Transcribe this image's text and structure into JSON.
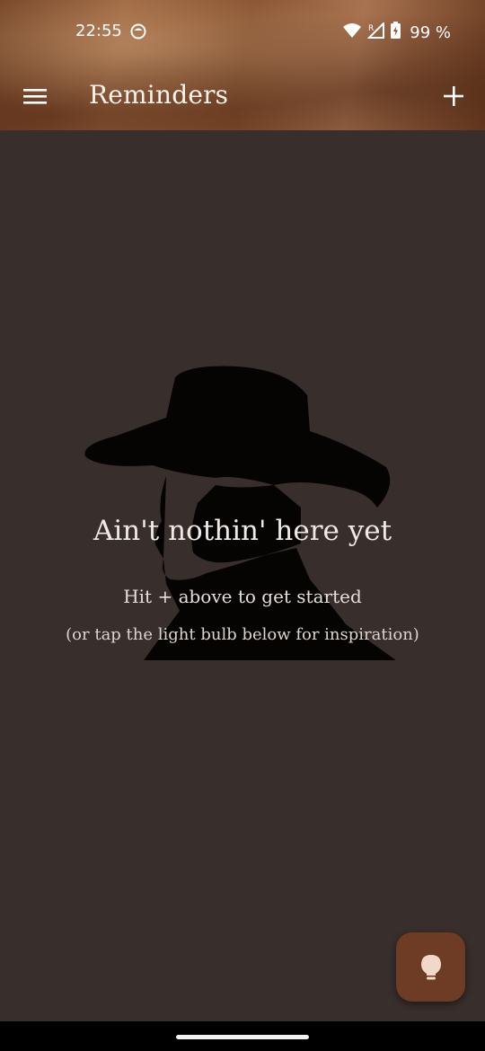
{
  "status_bar": {
    "time": "22:55",
    "battery": "99 %",
    "icons": [
      "app-notification-icon",
      "wifi-icon",
      "cellular-roaming-icon",
      "battery-charging-icon"
    ]
  },
  "app_bar": {
    "title": "Reminders",
    "menu_icon": "hamburger-menu-icon",
    "add_icon": "plus-icon"
  },
  "empty_state": {
    "image": "cowboy-silhouette",
    "title": "Ain't nothin' here yet",
    "subtitle": "Hit + above to get started",
    "hint": "(or tap the light bulb below for inspiration)"
  },
  "fab": {
    "icon": "lightbulb-icon"
  },
  "colors": {
    "background": "#382e2c",
    "fab": "#6e3b25",
    "fab_icon": "#f1d9c9",
    "header": "#8a5533"
  }
}
